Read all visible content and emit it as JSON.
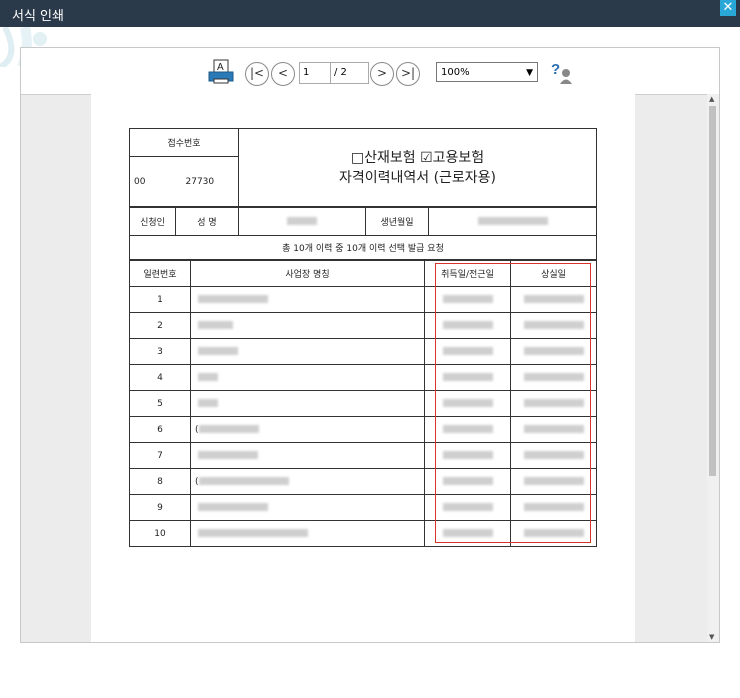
{
  "window": {
    "title": "서식 인쇄",
    "close_label": "✕"
  },
  "toolbar": {
    "current_page": "1",
    "total_pages": "/ 2",
    "zoom": "100%",
    "print_icon": "print-icon",
    "help_icon": "help-icon"
  },
  "form": {
    "receipt_no_label": "접수번호",
    "receipt_no_value": "00              27730",
    "title_line1_box1": "□",
    "title_line1_ins1": "산재보험",
    "title_line1_box2": "☑",
    "title_line1_ins2": "고용보험",
    "title_line2": "자격이력내역서 (근로자용)",
    "applicant_label": "신청인",
    "name_label": "성 명",
    "birth_label": "생년월일",
    "summary": "총 10개 이력 중 10개 이력 선택 발급 요청",
    "col_no": "일련번호",
    "col_company": "사업장 명칭",
    "col_acquire": "취득일/전근일",
    "col_lose": "상실일",
    "rows": [
      {
        "no": "1",
        "initial": " "
      },
      {
        "no": "2",
        "initial": " "
      },
      {
        "no": "3",
        "initial": " "
      },
      {
        "no": "4",
        "initial": " "
      },
      {
        "no": "5",
        "initial": " "
      },
      {
        "no": "6",
        "initial": "("
      },
      {
        "no": "7",
        "initial": " "
      },
      {
        "no": "8",
        "initial": "("
      },
      {
        "no": "9",
        "initial": " "
      },
      {
        "no": "10",
        "initial": " "
      }
    ]
  },
  "colors": {
    "titlebar": "#2b3a4a",
    "close": "#29a8d8",
    "highlight": "#d9342b"
  }
}
